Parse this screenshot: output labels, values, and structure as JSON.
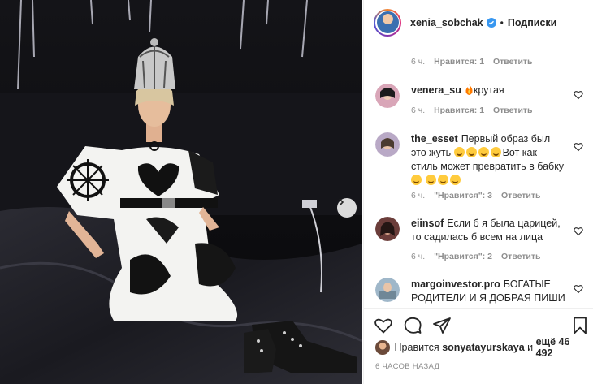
{
  "header": {
    "username": "xenia_sobchak",
    "dot": "•",
    "follow_state": "Подписки"
  },
  "comments": [
    {
      "user": "",
      "text": "",
      "meta": {
        "time": "6 ч.",
        "likes": "Нравится: 1",
        "reply": "Ответить"
      }
    },
    {
      "user": "venera_su",
      "text": "крутая",
      "emojis": [
        "fire"
      ],
      "meta": {
        "time": "6 ч.",
        "likes": "Нравится: 1",
        "reply": "Ответить"
      }
    },
    {
      "user": "the_esset",
      "text_1": "Первый образ был это жуть",
      "text_2": "Вот как стиль может превратить в бабку",
      "meta": {
        "time": "6 ч.",
        "likes": "\"Нравится\": 3",
        "reply": "Ответить"
      }
    },
    {
      "user": "eiinsof",
      "text": "Если б я была царицей, то садилась б всем на лица",
      "meta": {
        "time": "6 ч.",
        "likes": "\"Нравится\": 2",
        "reply": "Ответить"
      }
    },
    {
      "user": "margoinvestor.pro",
      "text": "БОГАТЫЕ РОДИТЕЛИ И Я ДОБРАЯ ПИШИ"
    }
  ],
  "likes": {
    "prefix": "Нравится",
    "user": "sonyatayurskaya",
    "middle": "и",
    "count_text": "ещё 46 492"
  },
  "timestamp": "6 ЧАСОВ НАЗАД",
  "icons": {
    "header_badge": "verified-badge-icon",
    "next": "chevron-right-icon",
    "actions": [
      "heart-icon",
      "comment-icon",
      "share-icon",
      "bookmark-icon"
    ]
  },
  "colors": {
    "accent_blue": "#3897f0",
    "muted": "#8e8e8e",
    "text": "#262626"
  }
}
